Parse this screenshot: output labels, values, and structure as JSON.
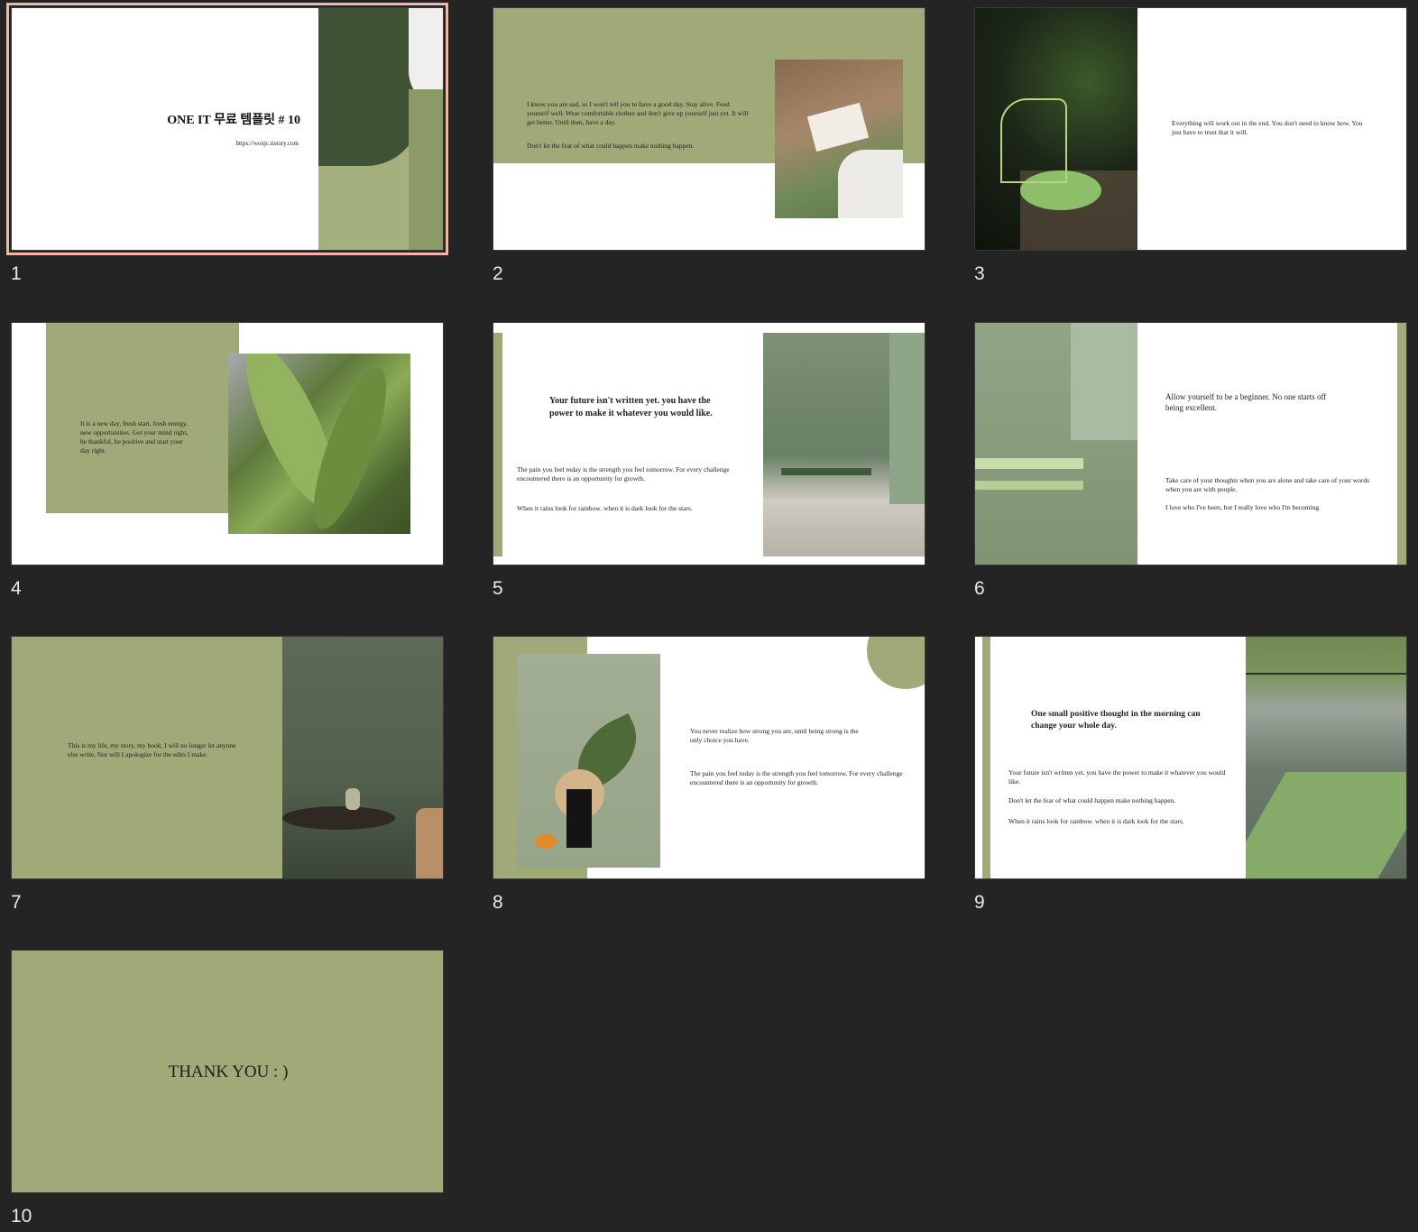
{
  "colors": {
    "background": "#242424",
    "sage": "#a0aa78",
    "dark_green": "#3f5233",
    "selection": "#f0b8a4"
  },
  "slides": [
    {
      "number": "1",
      "title": "ONE IT 무료 템플릿 # 10",
      "url": "https://wonjc.tistory.com"
    },
    {
      "number": "2",
      "text1": "I know you are sad, so I won't tell you to have a good day. Stay alive. Feed yourself well. Wear comfortable clothes and don't give up yourself just yet. It will get better. Until then, have a day.",
      "text2": "Don't let the fear of what could happen make nothing happen."
    },
    {
      "number": "3",
      "text1": "Everything will work out in the end. You don't need to know how. You just have to trust that it will."
    },
    {
      "number": "4",
      "text1": "It is a new day, fresh start, fresh energy, new opportunities. Get your mind right, be thankful, be positive and start your day right."
    },
    {
      "number": "5",
      "heading": "Your future isn't written yet. you have the power to make it whatever you would like.",
      "text1": "The pain you feel today is the strength you feel tomorrow. For every challenge encountered there is an opportunity for growth.",
      "text2": "When it rains look for rainbow. when it is dark look for the stars."
    },
    {
      "number": "6",
      "heading": "Allow yourself to be a beginner. No one starts off being excellent.",
      "text1": "Take care of your thoughts when you are alone and take care of your words when you are with people.",
      "text2": "I love who I've been, but I really love who I'm becoming."
    },
    {
      "number": "7",
      "text1": "This is my life, my story, my book. I will no longer let anyone else write, Nor will I apologize for the edits I make."
    },
    {
      "number": "8",
      "text1": "You never realize how strong you are, until being strong is the only choice you have.",
      "text2": "The pain you feel today is the strength you feel tomorrow. For every challenge encountered there is an opportunity for growth."
    },
    {
      "number": "9",
      "heading": "One small positive thought in the morning can change your whole day.",
      "text1": "Your future isn't written yet. you have the power to make it whatever you would like.",
      "text2": "Don't let the fear of what could happen make nothing happen.",
      "text3": "When it rains look for rainbow. when it is dark look for the stars."
    },
    {
      "number": "10",
      "title": "THANK YOU : )"
    }
  ]
}
